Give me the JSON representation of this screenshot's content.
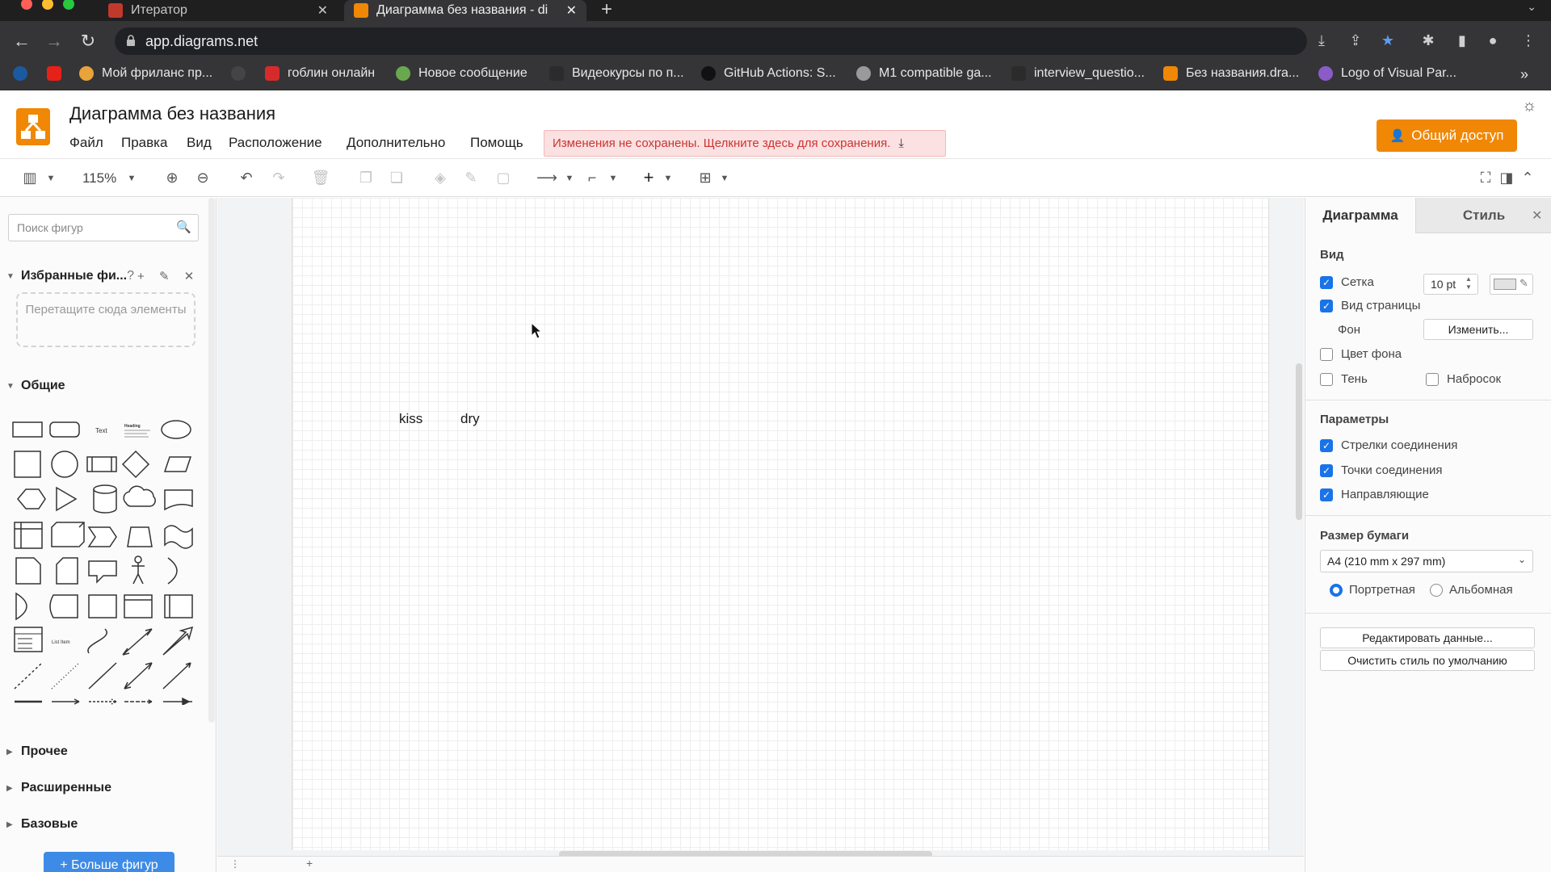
{
  "browser": {
    "tabs": [
      {
        "title": "Итератор",
        "active": false
      },
      {
        "title": "Диаграмма без названия - di",
        "active": true
      }
    ],
    "url": "app.diagrams.net",
    "bookmarks": [
      {
        "label": "Мой фриланс пр...",
        "color": "#e8a33a"
      },
      {
        "label": "гоблин онлайн",
        "color": "#d62b2b"
      },
      {
        "label": "Новое сообщение",
        "color": "#6aa84f"
      },
      {
        "label": "Видеокурсы по п...",
        "color": "#2b2b2b"
      },
      {
        "label": "GitHub Actions: S...",
        "color": "#111111"
      },
      {
        "label": "M1 compatible ga...",
        "color": "#9a9a9a"
      },
      {
        "label": "interview_questio...",
        "color": "#2b2b2b"
      },
      {
        "label": "Без названия.dra...",
        "color": "#f08705"
      },
      {
        "label": "Logo of Visual Par...",
        "color": "#8a5cc8"
      }
    ]
  },
  "app": {
    "title": "Диаграмма без названия",
    "menu": [
      "Файл",
      "Правка",
      "Вид",
      "Расположение",
      "Дополнительно",
      "Помощь"
    ],
    "unsaved_notice": "Изменения не сохранены. Щелкните здесь для сохранения.",
    "share_label": "Общий доступ",
    "accent": "#f08705"
  },
  "toolbar": {
    "zoom": "115%"
  },
  "left_panel": {
    "search_placeholder": "Поиск фигур",
    "favorites_title": "Избранные фи...",
    "favorites_help": "?",
    "dropzone_text": "Перетащите сюда элементы",
    "general_title": "Общие",
    "shape_text_label": "Text",
    "shape_heading_label": "Heading",
    "shape_list_label": "List Item",
    "other_title": "Прочее",
    "advanced_title": "Расширенные",
    "basic_title": "Базовые",
    "more_shapes_label": "+ Больше фигур"
  },
  "canvas": {
    "cells": [
      {
        "text": "kiss"
      },
      {
        "text": "dry"
      }
    ]
  },
  "right_panel": {
    "tab_diagram": "Диаграмма",
    "tab_style": "Стиль",
    "view_title": "Вид",
    "grid_label": "Сетка",
    "grid_checked": true,
    "grid_size": "10 pt",
    "page_view_label": "Вид страницы",
    "page_view_checked": true,
    "background_label": "Фон",
    "change_button": "Изменить...",
    "bg_color_label": "Цвет фона",
    "bg_color_checked": false,
    "shadow_label": "Тень",
    "shadow_checked": false,
    "sketch_label": "Набросок",
    "sketch_checked": false,
    "options_title": "Параметры",
    "connection_arrows_label": "Стрелки соединения",
    "connection_points_label": "Точки соединения",
    "guides_label": "Направляющие",
    "paper_size_title": "Размер бумаги",
    "paper_size_value": "A4 (210 mm x 297 mm)",
    "portrait_label": "Портретная",
    "landscape_label": "Альбомная",
    "edit_data_button": "Редактировать данные...",
    "clear_style_button": "Очистить стиль по умолчанию"
  }
}
